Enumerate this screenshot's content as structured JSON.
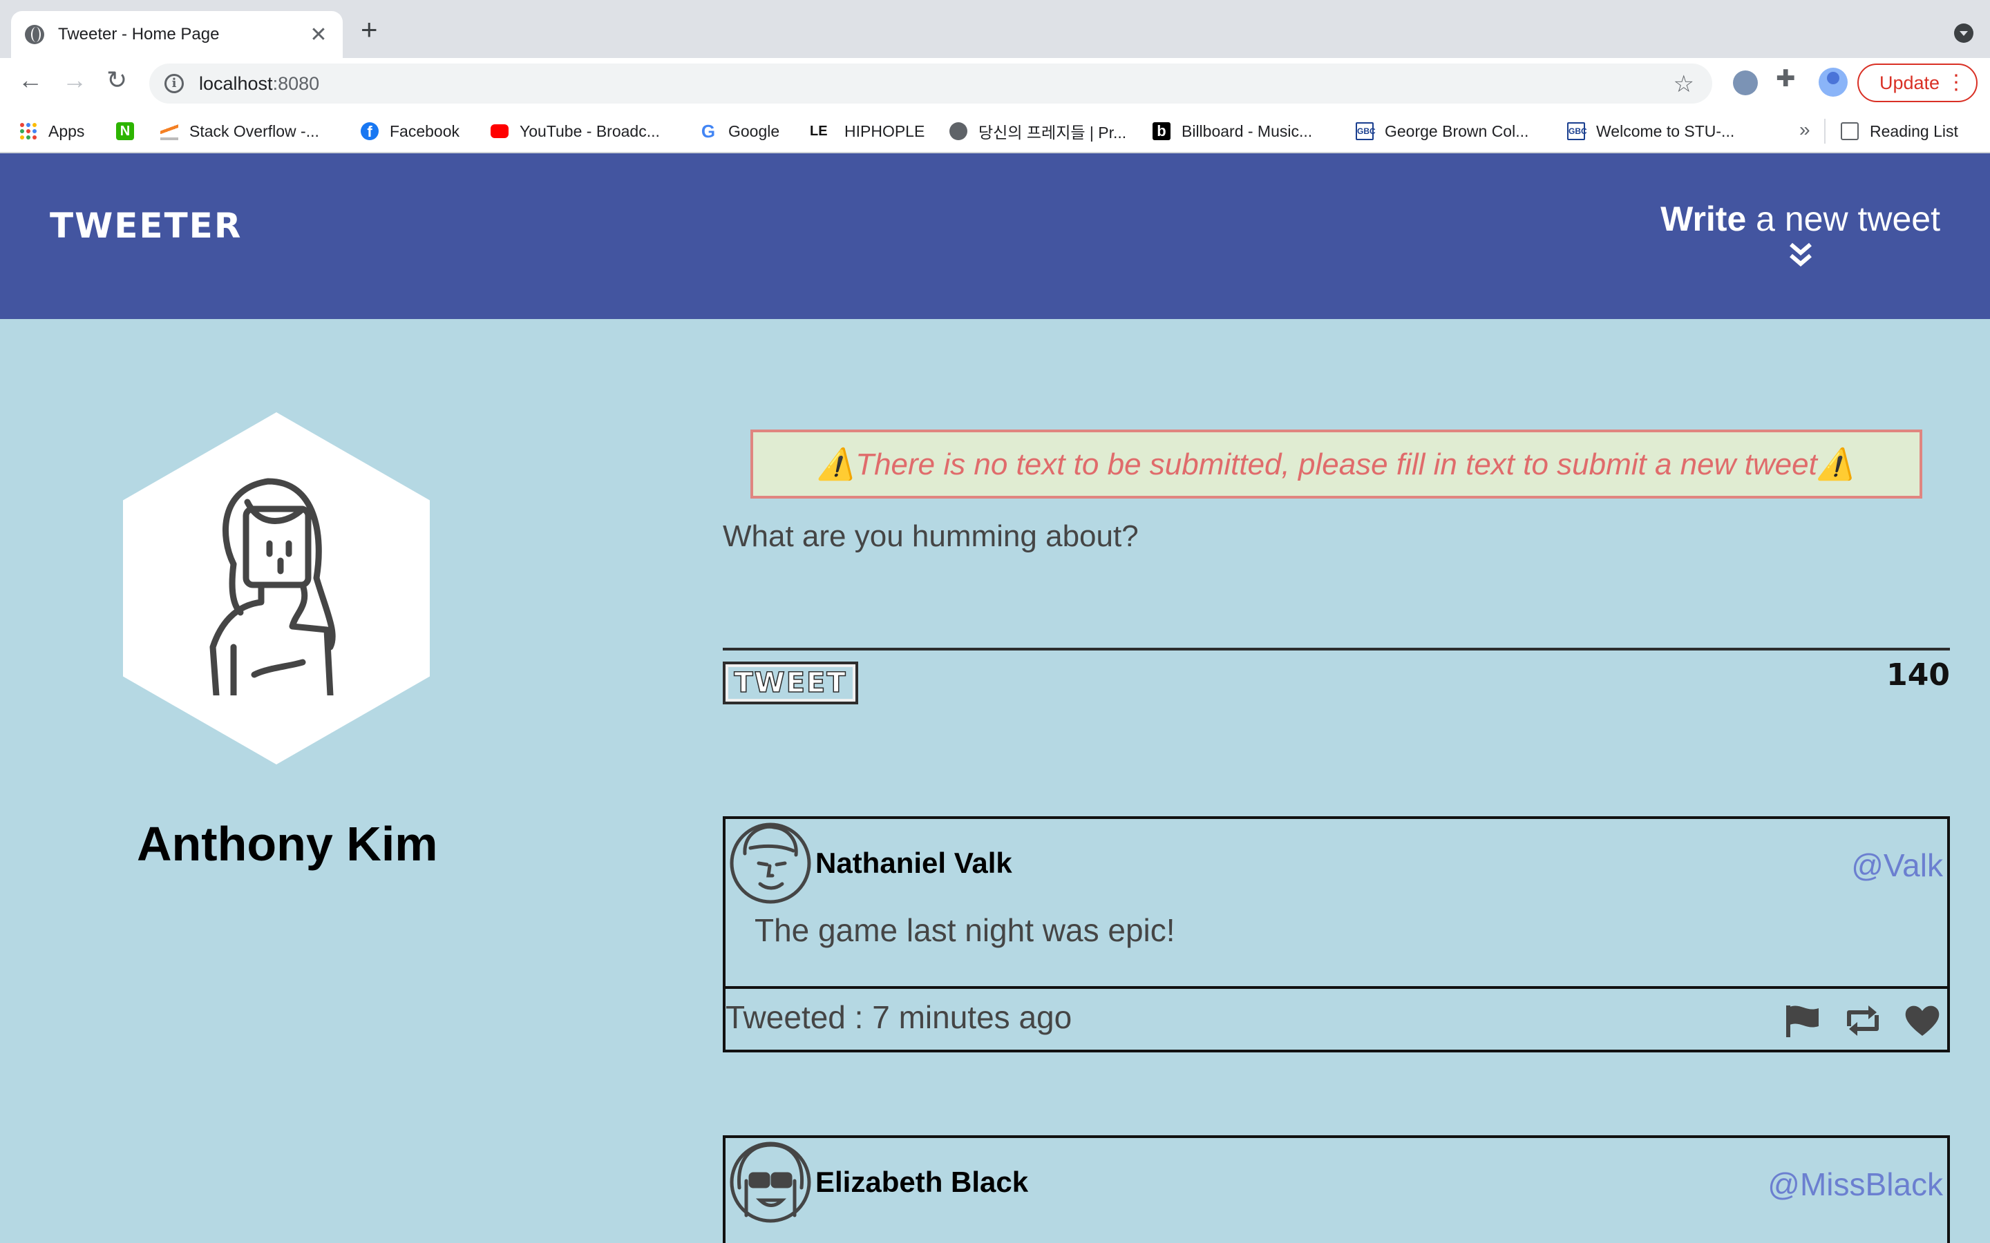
{
  "browser": {
    "tab_title": "Tweeter - Home Page",
    "new_tab_symbol": "+",
    "url_host": "localhost",
    "url_port": ":8080",
    "update_label": "Update",
    "bookmarks": [
      {
        "label": "Apps",
        "icon": "apps-grid-icon",
        "color": "#4285f4"
      },
      {
        "label": "",
        "icon": "naver-icon",
        "color": "#2db400"
      },
      {
        "label": "Stack Overflow -...",
        "icon": "stackoverflow-icon",
        "color": "#f48024"
      },
      {
        "label": "Facebook",
        "icon": "facebook-icon",
        "color": "#1877f2"
      },
      {
        "label": "YouTube - Broadc...",
        "icon": "youtube-icon",
        "color": "#ff0000"
      },
      {
        "label": "Google",
        "icon": "google-icon",
        "color": "#4285f4"
      },
      {
        "label": "HIPHOPLE",
        "icon": "hiphople-icon",
        "color": "#111111"
      },
      {
        "label": "당신의 프레지들 | Pr...",
        "icon": "globe-icon",
        "color": "#5f6368"
      },
      {
        "label": "Billboard - Music...",
        "icon": "billboard-icon",
        "color": "#000000"
      },
      {
        "label": "George Brown Col...",
        "icon": "gbc-icon",
        "color": "#1a3f8f"
      },
      {
        "label": "Welcome to STU-...",
        "icon": "gbc-icon",
        "color": "#1a3f8f"
      }
    ],
    "more_bookmarks": "»",
    "reading_list": "Reading List"
  },
  "nav": {
    "brand": "TWEETER",
    "compose_bold": "Write",
    "compose_rest": " a new tweet"
  },
  "profile": {
    "name": "Anthony Kim"
  },
  "composer": {
    "error": "⚠️There is no text to be submitted, please fill in text to submit a new tweet⚠️",
    "placeholder": "What are you humming about?",
    "button_label": "TWEET",
    "counter": "140"
  },
  "tweets": [
    {
      "author": "Nathaniel Valk",
      "handle": "@Valk",
      "text": "The game last night was epic!",
      "time": "Tweeted : 7 minutes ago"
    },
    {
      "author": "Elizabeth Black",
      "handle": "@MissBlack",
      "text": "",
      "time": ""
    }
  ],
  "colors": {
    "nav_bg": "#4355a0",
    "page_bg": "#b5d8e3",
    "handle": "#6b7fd0",
    "error_text": "#e06b6b",
    "error_border": "#e08580",
    "error_bg": "#e0ecd2"
  }
}
